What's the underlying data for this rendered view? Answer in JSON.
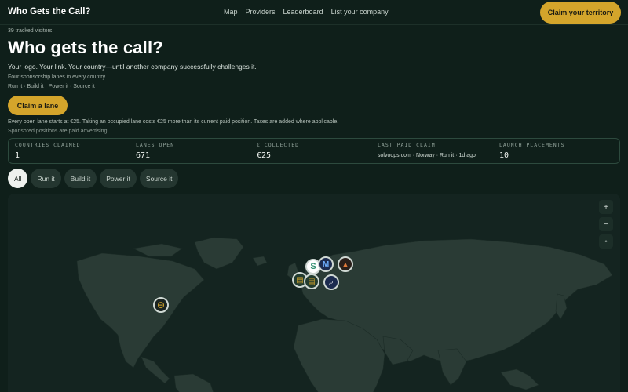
{
  "header": {
    "brand": "Who Gets the Call?",
    "nav": [
      "Map",
      "Providers",
      "Leaderboard",
      "List your company"
    ],
    "cta": "Claim your territory"
  },
  "hero": {
    "visitors": "39 tracked visitors",
    "title": "Who gets the call?",
    "tagline": "Your logo. Your link. Your country—until another company successfully challenges it.",
    "lanes_note": "Four sponsorship lanes in every country.",
    "lanes_list": "Run it · Build it · Power it · Source it",
    "claim_button": "Claim a lane",
    "pricing": "Every open lane starts at €25. Taking an occupied lane costs €25 more than its current paid position. Taxes are added where applicable.",
    "sponsored": "Sponsored positions are paid advertising."
  },
  "stats": {
    "countries_label": "Countries claimed",
    "countries_value": "1",
    "lanes_label": "Lanes open",
    "lanes_value": "671",
    "collected_label": "€ collected",
    "collected_value": "€25",
    "last_label": "Last paid claim",
    "last_company": "solvoops.com",
    "last_detail": " · Norway · Run it · 1d ago",
    "launch_label": "Launch placements",
    "launch_value": "10"
  },
  "filters": [
    "All",
    "Run it",
    "Build it",
    "Power it",
    "Source it"
  ],
  "map": {
    "zoom_in": "+",
    "zoom_out": "−",
    "reset": "◦",
    "colors": {
      "land": "#2a3b35",
      "ocean": "#142420",
      "accent": "#d4a52b"
    },
    "markers": [
      {
        "name": "north-america-marker",
        "glyph": "⊖",
        "color": "#d4a52b"
      },
      {
        "name": "europe-marker-s",
        "glyph": "S",
        "color": "#ffffff"
      },
      {
        "name": "europe-marker-m",
        "glyph": "M",
        "color": "#2f6fd6"
      },
      {
        "name": "europe-marker-a",
        "glyph": "▲",
        "color": "#e07a3a"
      },
      {
        "name": "europe-marker-card-1",
        "glyph": "▤",
        "color": "#d4a52b"
      },
      {
        "name": "europe-marker-card-2",
        "glyph": "▤",
        "color": "#d4a52b"
      },
      {
        "name": "europe-marker-search",
        "glyph": "⌕",
        "color": "#ffffff"
      }
    ]
  }
}
